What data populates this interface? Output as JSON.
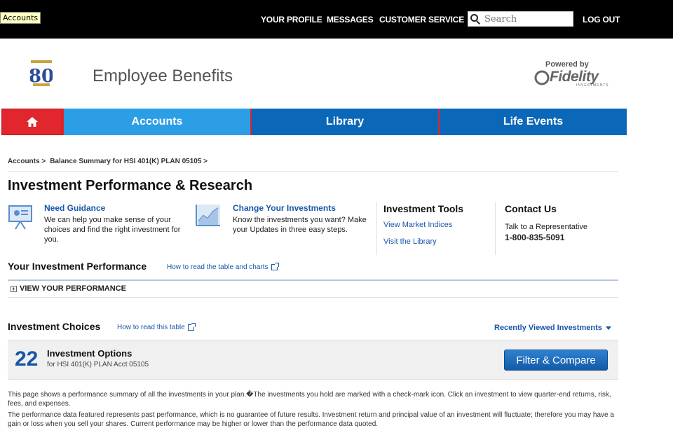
{
  "tooltip": {
    "text": "Accounts"
  },
  "topnav": {
    "profile": "YOUR PROFILE",
    "messages": "MESSAGES",
    "customer_service": "CUSTOMER SERVICE",
    "search_placeholder": "Search",
    "logout": "LOG OUT"
  },
  "header": {
    "title": "Employee Benefits",
    "powered_by": "Powered by",
    "fidelity_word": "Fidelity",
    "fidelity_sub": "INVESTMENTS"
  },
  "mainnav": {
    "tabs": [
      {
        "label": "Accounts"
      },
      {
        "label": "Library"
      },
      {
        "label": "Life Events"
      }
    ]
  },
  "breadcrumb": {
    "items": [
      "Accounts >",
      "Balance Summary for HSI 401(K) PLAN 05105 >"
    ]
  },
  "page": {
    "title": "Investment Performance & Research"
  },
  "guidance": {
    "title": "Need Guidance",
    "text": "We can help you make sense of your choices and find the right investment for you."
  },
  "change": {
    "title": "Change Your Investments",
    "text": "Know the investments you want? Make your Updates in three easy steps."
  },
  "tools": {
    "title": "Investment Tools",
    "links": [
      "View Market Indices",
      "Visit the Library"
    ]
  },
  "contact": {
    "title": "Contact Us",
    "text": "Talk to a Representative",
    "phone": "1-800-835-5091"
  },
  "performance": {
    "title": "Your Investment Performance",
    "link": "How to read the table and charts",
    "toggle": "VIEW YOUR PERFORMANCE"
  },
  "choices": {
    "title": "Investment Choices",
    "link": "How to read this table",
    "recent": "Recently Viewed Investments",
    "count": "22",
    "options_title": "Investment Options",
    "options_sub": "for HSI 401(K) PLAN Acct 05105",
    "filter_button": "Filter & Compare"
  },
  "disclaimers": [
    "This page shows a performance summary of all the investments in your plan.�The investments you hold are marked with a check-mark icon. Click an investment to view quarter-end returns, risk, fees, and expenses.",
    "The performance data featured represents past performance, which is no guarantee of future results. Investment return and principal value of an investment will fluctuate; therefore you may have a gain or loss when you sell your shares. Current performance may be higher or lower than the performance data quoted."
  ],
  "colors": {
    "topbar": "#000000",
    "home_tab": "#e1262d",
    "active_tab": "#2c9ee6",
    "tab": "#0b67b8",
    "link": "#1a56a8"
  }
}
